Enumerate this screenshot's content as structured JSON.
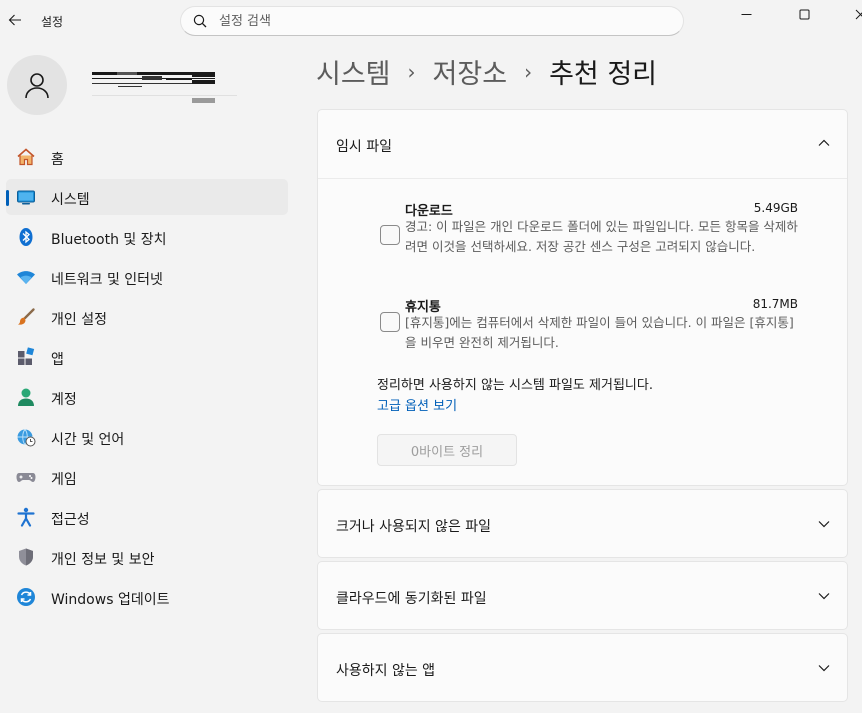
{
  "app": {
    "title": "설정"
  },
  "search": {
    "placeholder": "설정 검색"
  },
  "nav": {
    "items": [
      {
        "label": "홈",
        "icon": "home-icon"
      },
      {
        "label": "시스템",
        "icon": "system-icon",
        "selected": true
      },
      {
        "label": "Bluetooth 및 장치",
        "icon": "bluetooth-icon"
      },
      {
        "label": "네트워크 및 인터넷",
        "icon": "wifi-icon"
      },
      {
        "label": "개인 설정",
        "icon": "brush-icon"
      },
      {
        "label": "앱",
        "icon": "apps-icon"
      },
      {
        "label": "계정",
        "icon": "account-icon"
      },
      {
        "label": "시간 및 언어",
        "icon": "globe-clock-icon"
      },
      {
        "label": "게임",
        "icon": "gamepad-icon"
      },
      {
        "label": "접근성",
        "icon": "accessibility-icon"
      },
      {
        "label": "개인 정보 및 보안",
        "icon": "shield-icon"
      },
      {
        "label": "Windows 업데이트",
        "icon": "update-icon"
      }
    ]
  },
  "breadcrumb": {
    "parts": [
      "시스템",
      "저장소"
    ],
    "separator": "›",
    "current": "추천 정리"
  },
  "temp_files": {
    "title": "임시 파일",
    "items": [
      {
        "name": "다운로드",
        "size": "5.49GB",
        "desc": "경고: 이 파일은 개인 다운로드 폴더에 있는 파일입니다. 모든 항목을 삭제하려면 이것을 선택하세요. 저장 공간 센스 구성은 고려되지 않습니다."
      },
      {
        "name": "휴지통",
        "size": "81.7MB",
        "desc": "[휴지통]에는 컴퓨터에서 삭제한 파일이 들어 있습니다. 이 파일은 [휴지통]을 비우면 완전히 제거됩니다."
      }
    ],
    "note": "정리하면 사용하지 않는 시스템 파일도 제거됩니다.",
    "advanced_link": "고급 옵션 보기",
    "clean_button": "0바이트 정리"
  },
  "sections": [
    {
      "title": "크거나 사용되지 않은 파일"
    },
    {
      "title": "클라우드에 동기화된 파일"
    },
    {
      "title": "사용하지 않는 앱"
    }
  ],
  "colors": {
    "accent": "#005fb8",
    "background": "#f3f3f3",
    "card": "#fbfbfb"
  }
}
